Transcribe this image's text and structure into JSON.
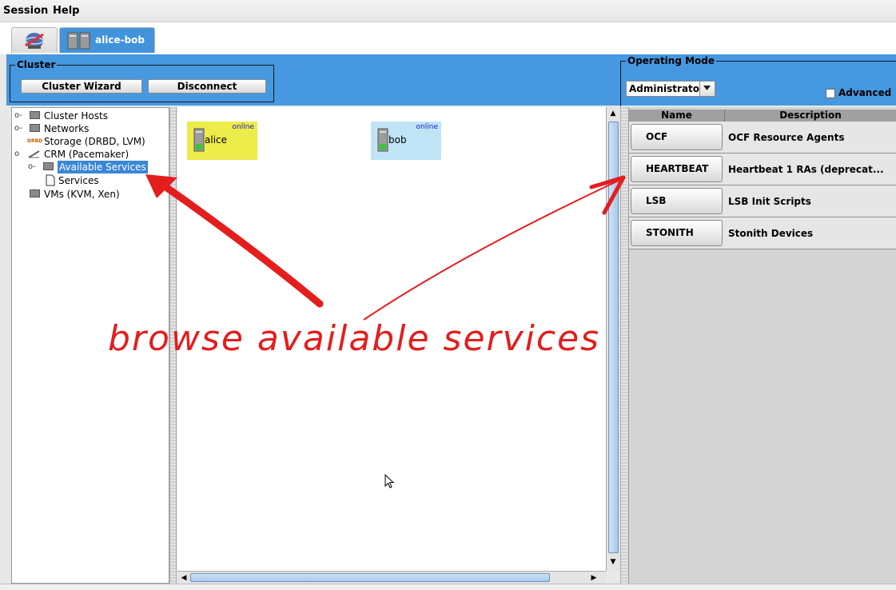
{
  "menubar": {
    "session_label": "Session",
    "help_label": "Help"
  },
  "tabs": [
    {
      "label": "",
      "icon": "globe-icon"
    },
    {
      "label": "alice-bob",
      "icon": "cluster-icon"
    }
  ],
  "toolbar": {
    "cluster_group_title": "Cluster",
    "cluster_wizard_label": "Cluster Wizard",
    "disconnect_label": "Disconnect",
    "operating_mode_title": "Operating Mode",
    "operating_mode_value": "Administrator",
    "advanced_label": "Advanced"
  },
  "tree": {
    "items": [
      {
        "label": "Cluster Hosts",
        "icon": "folder-icon"
      },
      {
        "label": "Networks",
        "icon": "folder-icon"
      },
      {
        "label": "Storage (DRBD, LVM)",
        "icon": "drbd-icon",
        "badge": "DRBD"
      },
      {
        "label": "CRM (Pacemaker)",
        "icon": "pacemaker-icon"
      },
      {
        "label": "Available Services",
        "icon": "folder-icon",
        "selected": true
      },
      {
        "label": "Services",
        "icon": "document-icon"
      },
      {
        "label": "VMs (KVM, Xen)",
        "icon": "folder-icon"
      }
    ]
  },
  "graph": {
    "hosts": [
      {
        "name": "alice",
        "status": "online",
        "color": "#ecec4a"
      },
      {
        "name": "bob",
        "status": "online",
        "color": "#bfe4f6"
      }
    ]
  },
  "services_table": {
    "headers": [
      "Name",
      "Description"
    ],
    "rows": [
      {
        "name": "OCF",
        "description": "OCF Resource Agents"
      },
      {
        "name": "HEARTBEAT",
        "description": "Heartbeat 1 RAs (deprecat..."
      },
      {
        "name": "LSB",
        "description": "LSB Init Scripts"
      },
      {
        "name": "STONITH",
        "description": "Stonith Devices"
      }
    ]
  },
  "annotation": {
    "text": "browse available services",
    "color": "#e41d1d"
  },
  "colors": {
    "toolbar_blue": "#4698e0",
    "selection_blue": "#3a86d6"
  }
}
